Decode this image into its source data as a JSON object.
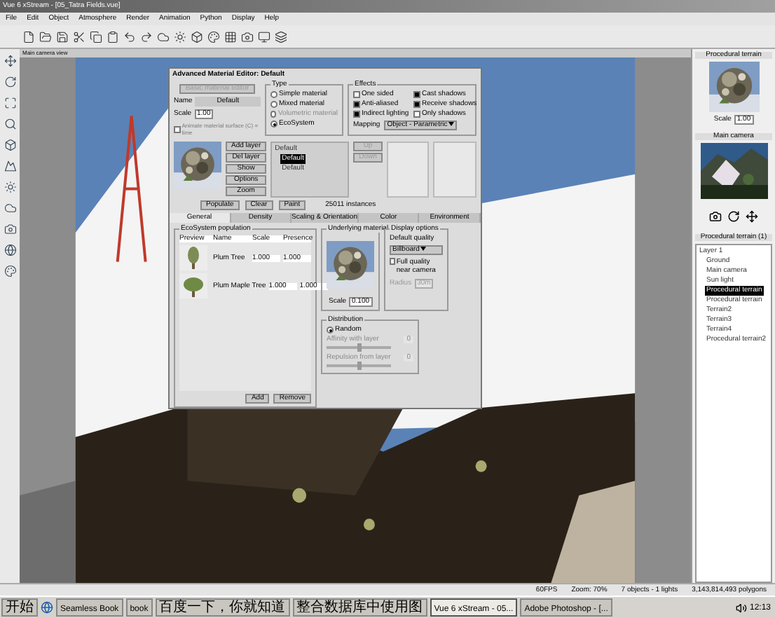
{
  "window": {
    "title": "Vue 6 xStream - [05_Tatra Fields.vue]"
  },
  "menu": [
    "File",
    "Edit",
    "Object",
    "Atmosphere",
    "Render",
    "Animation",
    "Python",
    "Display",
    "Help"
  ],
  "viewport": {
    "title": "Main camera view"
  },
  "dialog": {
    "title": "Advanced Material Editor: Default",
    "basic_button": "Basic material editor",
    "name_label": "Name",
    "name_value": "Default",
    "scale_label": "Scale",
    "scale_value": "1.00",
    "animate": {
      "label": "Animate material surface (C) = time",
      "checked": false
    },
    "type": {
      "title": "Type",
      "options": [
        {
          "label": "Simple material",
          "selected": false,
          "disabled": false
        },
        {
          "label": "Mixed material",
          "selected": false,
          "disabled": false
        },
        {
          "label": "Volumetric material",
          "selected": false,
          "disabled": true
        },
        {
          "label": "EcoSystem",
          "selected": true,
          "disabled": false
        }
      ]
    },
    "effects": {
      "title": "Effects",
      "options": [
        {
          "label": "One sided",
          "checked": false
        },
        {
          "label": "Cast shadows",
          "checked": true
        },
        {
          "label": "Anti-aliased",
          "checked": true
        },
        {
          "label": "Receive shadows",
          "checked": true
        },
        {
          "label": "Indirect lighting",
          "checked": true
        },
        {
          "label": "Only shadows",
          "checked": false
        }
      ],
      "mapping_label": "Mapping",
      "mapping_value": "Object - Parametric"
    },
    "side_buttons": [
      "Add layer",
      "Del layer",
      "Show",
      "Options",
      "Zoom"
    ],
    "layers": [
      {
        "label": "Default",
        "selected": false,
        "children": [
          {
            "label": "Default",
            "selected": true
          },
          {
            "label": "Default",
            "selected": false
          }
        ]
      }
    ],
    "move_buttons": [
      {
        "label": "Up",
        "disabled": true
      },
      {
        "label": "Down",
        "disabled": true
      }
    ],
    "action_buttons": [
      "Populate",
      "Clear",
      "Paint"
    ],
    "instances": "25011 instances",
    "tabs": [
      {
        "label": "General",
        "selected": true
      },
      {
        "label": "Density",
        "selected": false
      },
      {
        "label": "Scaling & Orientation",
        "selected": false
      },
      {
        "label": "Color",
        "selected": false
      },
      {
        "label": "Environment",
        "selected": false
      }
    ],
    "population": {
      "title": "EcoSystem population",
      "columns": [
        "Preview",
        "Name",
        "Scale",
        "Presence"
      ],
      "rows": [
        {
          "name": "Plum Tree",
          "scale": "1.000",
          "presence": "1.000"
        },
        {
          "name": "Plum Maple Tree",
          "scale": "1.000",
          "presence": "1.000"
        }
      ],
      "buttons": [
        "Add",
        "Remove"
      ]
    },
    "underlying": {
      "title": "Underlying material",
      "scale_label": "Scale",
      "scale_value": "0.100"
    },
    "display": {
      "title": "Display options",
      "quality_label": "Default quality",
      "quality_value": "Billboard",
      "full_quality": {
        "label": "Full quality near camera",
        "checked": false
      },
      "radius_label": "Radius",
      "radius_value": "30m"
    },
    "distribution": {
      "title": "Distribution",
      "mode": {
        "label": "Random",
        "selected": true
      },
      "sliders": [
        {
          "label": "Affinity with layer",
          "level": 0.5,
          "value": "0"
        },
        {
          "label": "Repulsion from layer",
          "level": 0.5,
          "value": "0"
        }
      ]
    }
  },
  "right_panel": {
    "material_title": "Procedural terrain",
    "scale_label": "Scale",
    "scale_value": "1.00",
    "camera_title": "Main camera",
    "objects_title": "Procedural terrain (1)",
    "tree": [
      {
        "label": "Layer 1",
        "selected": false,
        "children": [
          {
            "label": "Ground",
            "selected": false
          },
          {
            "label": "Main camera",
            "selected": false
          },
          {
            "label": "Sun light",
            "selected": false
          },
          {
            "label": "Procedural terrain",
            "selected": true
          },
          {
            "label": "Procedural terrain",
            "selected": false
          },
          {
            "label": "Terrain2",
            "selected": false
          },
          {
            "label": "Terrain3",
            "selected": false
          },
          {
            "label": "Terrain4",
            "selected": false
          },
          {
            "label": "Procedural terrain2",
            "selected": false
          }
        ]
      }
    ]
  },
  "status_bar": [
    "60FPS",
    "Zoom: 70%",
    "7 objects - 1 lights",
    "3,143,814,493 polygons"
  ],
  "taskbar": {
    "start": "开始",
    "items": [
      {
        "label": "Seamless Book",
        "selected": false
      },
      {
        "label": "book",
        "selected": false
      },
      {
        "label": "百度一下，你就知道",
        "selected": false
      },
      {
        "label": "整合数据库中使用图",
        "selected": false
      },
      {
        "label": "Vue 6 xStream - 05...",
        "selected": true
      },
      {
        "label": "Adobe Photoshop - [...",
        "selected": false
      }
    ],
    "clock": "12:13"
  }
}
